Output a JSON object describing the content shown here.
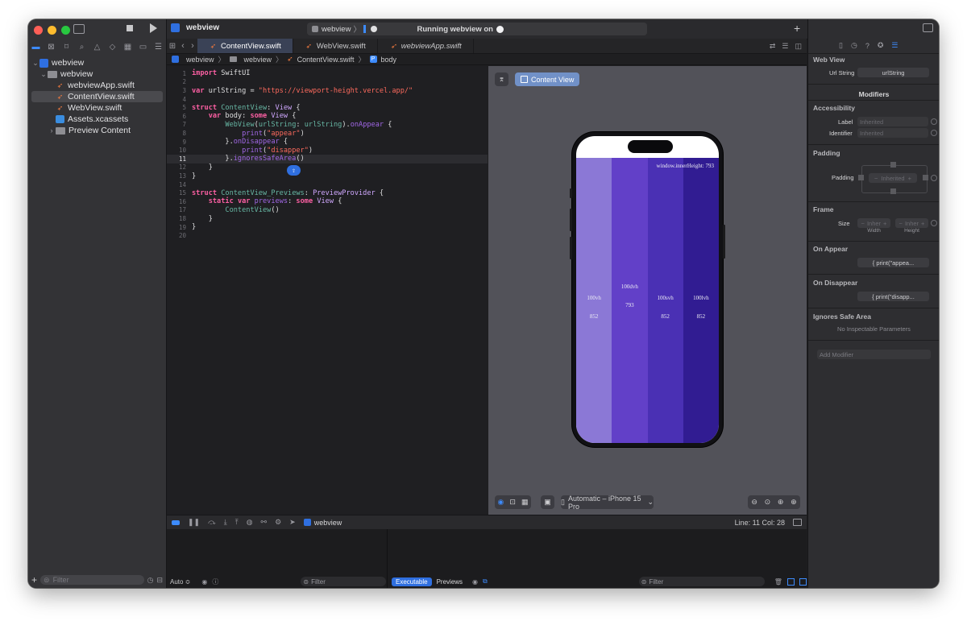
{
  "window": {
    "title": "webview",
    "run_status": "Running webview on",
    "scheme_name": "webview"
  },
  "colors": {
    "accent": "#2f6fe0",
    "swift_orange": "#f0793e",
    "selection": "#4a4a4e",
    "band1": "#8b78d6",
    "band2": "#6240c8",
    "band3": "#4a30b4",
    "band4": "#311c92"
  },
  "sidebar": {
    "tree": [
      {
        "label": "webview",
        "icon": "project-icon",
        "depth": 0,
        "expanded": true,
        "selected": false
      },
      {
        "label": "webview",
        "icon": "folder-icon",
        "depth": 1,
        "expanded": true,
        "selected": false
      },
      {
        "label": "webviewApp.swift",
        "icon": "swift-icon",
        "depth": 2,
        "selected": false
      },
      {
        "label": "ContentView.swift",
        "icon": "swift-icon",
        "depth": 2,
        "selected": true
      },
      {
        "label": "WebView.swift",
        "icon": "swift-icon",
        "depth": 2,
        "selected": false
      },
      {
        "label": "Assets.xcassets",
        "icon": "assets-icon",
        "depth": 2,
        "selected": false
      },
      {
        "label": "Preview Content",
        "icon": "folder-icon",
        "depth": 2,
        "expanded": false,
        "selected": false
      }
    ],
    "filter_placeholder": "Filter"
  },
  "tabs": [
    {
      "label": "ContentView.swift",
      "active": true
    },
    {
      "label": "WebView.swift",
      "active": false
    },
    {
      "label": "webviewApp.swift",
      "active": false
    }
  ],
  "jumpbar": {
    "items": [
      "webview",
      "webview",
      "ContentView.swift",
      "body"
    ]
  },
  "code": {
    "current_line": 11,
    "lines": [
      {
        "n": "1",
        "parts": [
          [
            "kw",
            "import"
          ],
          [
            "tx",
            " SwiftUI"
          ]
        ]
      },
      {
        "n": "2",
        "parts": []
      },
      {
        "n": "3",
        "parts": [
          [
            "kw",
            "var"
          ],
          [
            "tx",
            " urlString = "
          ],
          [
            "str",
            "\"https://viewport-height.vercel.app/\""
          ]
        ]
      },
      {
        "n": "4",
        "parts": []
      },
      {
        "n": "5",
        "parts": [
          [
            "kw",
            "struct"
          ],
          [
            "tx",
            " "
          ],
          [
            "id",
            "ContentView"
          ],
          [
            "tx",
            ": "
          ],
          [
            "ty",
            "View"
          ],
          [
            "tx",
            " {"
          ]
        ]
      },
      {
        "n": "6",
        "parts": [
          [
            "tx",
            "    "
          ],
          [
            "kw",
            "var"
          ],
          [
            "tx",
            " body: "
          ],
          [
            "kw",
            "some"
          ],
          [
            "tx",
            " "
          ],
          [
            "ty",
            "View"
          ],
          [
            "tx",
            " {"
          ]
        ]
      },
      {
        "n": "7",
        "parts": [
          [
            "tx",
            "        "
          ],
          [
            "id",
            "WebView"
          ],
          [
            "tx",
            "("
          ],
          [
            "id",
            "urlString"
          ],
          [
            "tx",
            ": "
          ],
          [
            "id",
            "urlString"
          ],
          [
            "tx",
            ")."
          ],
          [
            "fn",
            "onAppear"
          ],
          [
            "tx",
            " {"
          ]
        ]
      },
      {
        "n": "8",
        "parts": [
          [
            "tx",
            "            "
          ],
          [
            "fn",
            "print"
          ],
          [
            "tx",
            "("
          ],
          [
            "str",
            "\"appear\""
          ],
          [
            "tx",
            ")"
          ]
        ]
      },
      {
        "n": "9",
        "parts": [
          [
            "tx",
            "        }."
          ],
          [
            "fn",
            "onDisappear"
          ],
          [
            "tx",
            " {"
          ]
        ]
      },
      {
        "n": "10",
        "parts": [
          [
            "tx",
            "            "
          ],
          [
            "fn",
            "print"
          ],
          [
            "tx",
            "("
          ],
          [
            "str",
            "\"disapper\""
          ],
          [
            "tx",
            ")"
          ]
        ]
      },
      {
        "n": "11",
        "parts": [
          [
            "tx",
            "        }."
          ],
          [
            "fn",
            "ignoresSafeArea"
          ],
          [
            "tx",
            "()"
          ]
        ]
      },
      {
        "n": "12",
        "parts": [
          [
            "tx",
            "    }"
          ]
        ]
      },
      {
        "n": "13",
        "parts": [
          [
            "tx",
            "}"
          ]
        ]
      },
      {
        "n": "14",
        "parts": []
      },
      {
        "n": "15",
        "parts": [
          [
            "kw",
            "struct"
          ],
          [
            "tx",
            " "
          ],
          [
            "id",
            "ContentView_Previews"
          ],
          [
            "tx",
            ": "
          ],
          [
            "ty",
            "PreviewProvider"
          ],
          [
            "tx",
            " {"
          ]
        ]
      },
      {
        "n": "16",
        "parts": [
          [
            "tx",
            "    "
          ],
          [
            "kw",
            "static"
          ],
          [
            "tx",
            " "
          ],
          [
            "kw",
            "var"
          ],
          [
            "tx",
            " "
          ],
          [
            "fn",
            "previews"
          ],
          [
            "tx",
            ": "
          ],
          [
            "kw",
            "some"
          ],
          [
            "tx",
            " "
          ],
          [
            "ty",
            "View"
          ],
          [
            "tx",
            " {"
          ]
        ]
      },
      {
        "n": "17",
        "parts": [
          [
            "tx",
            "        "
          ],
          [
            "id",
            "ContentView"
          ],
          [
            "tx",
            "()"
          ]
        ]
      },
      {
        "n": "18",
        "parts": [
          [
            "tx",
            "    }"
          ]
        ]
      },
      {
        "n": "19",
        "parts": [
          [
            "tx",
            "}"
          ]
        ]
      },
      {
        "n": "20",
        "parts": []
      }
    ]
  },
  "canvas": {
    "preview_label": "Content View",
    "device_label": "Automatic – iPhone 15 Pro",
    "inner_height_text": "window.innerHeight: 793",
    "bands": [
      {
        "unit": "100vh",
        "value": "852"
      },
      {
        "unit": "100dvh",
        "value": "793"
      },
      {
        "unit": "100svh",
        "value": "852"
      },
      {
        "unit": "100lvh",
        "value": "852"
      }
    ]
  },
  "status": {
    "position": "Line: 11  Col: 28",
    "debug_target": "webview"
  },
  "debug": {
    "auto_label": "Auto ≎",
    "filter_placeholder": "Filter",
    "tab_executable": "Executable",
    "tab_previews": "Previews",
    "right_filter_placeholder": "Filter"
  },
  "inspector": {
    "web_view_title": "Web View",
    "url_string_label": "Url String",
    "url_string_value": "urlString",
    "modifiers_title": "Modifiers",
    "accessibility_title": "Accessibility",
    "label_label": "Label",
    "label_value": "Inherited",
    "identifier_label": "Identifier",
    "identifier_value": "Inherited",
    "padding_title": "Padding",
    "padding_label": "Padding",
    "padding_value": "Inherited",
    "frame_title": "Frame",
    "size_label": "Size",
    "width_value": "Inher",
    "height_value": "Inher",
    "width_caption": "Width",
    "height_caption": "Height",
    "on_appear_title": "On Appear",
    "on_appear_value": "{ print(\"appea...",
    "on_disappear_title": "On Disappear",
    "on_disappear_value": "{ print(\"disapp...",
    "ignores_title": "Ignores Safe Area",
    "ignores_note": "No Inspectable Parameters",
    "add_modifier": "Add Modifier"
  }
}
